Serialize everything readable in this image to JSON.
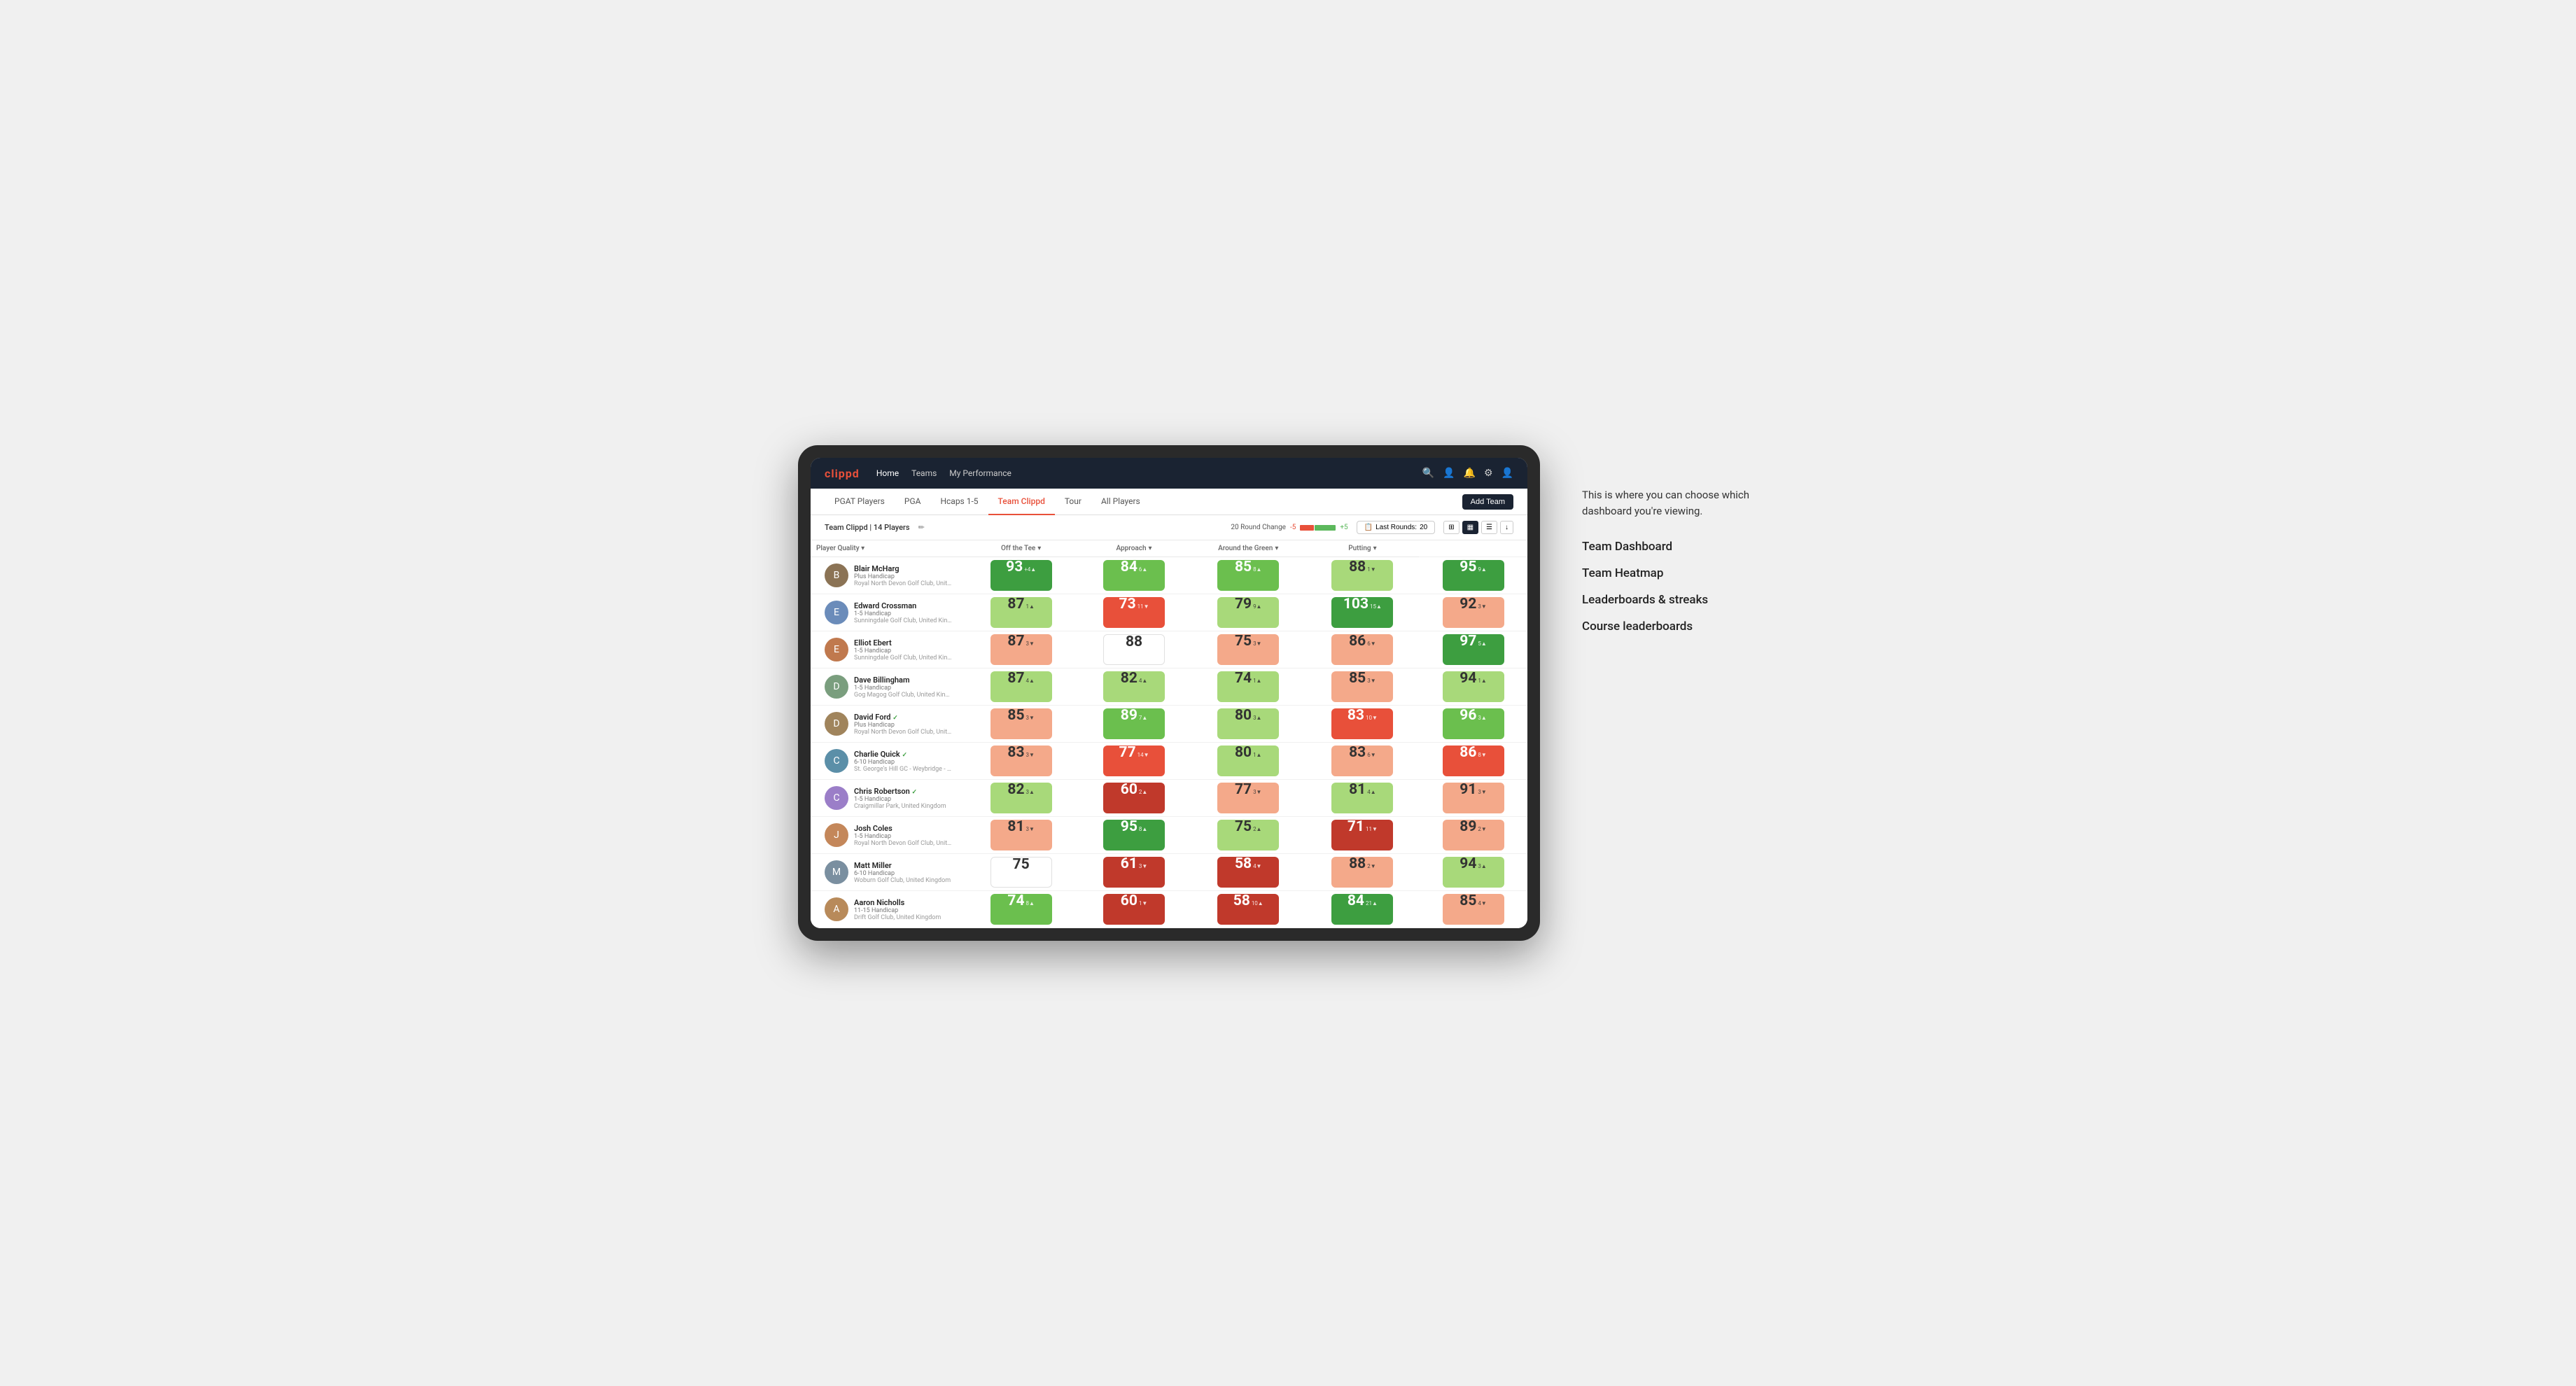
{
  "annotation": {
    "intro": "This is where you can choose which dashboard you're viewing.",
    "options": [
      {
        "id": "team-dashboard",
        "label": "Team Dashboard"
      },
      {
        "id": "team-heatmap",
        "label": "Team Heatmap"
      },
      {
        "id": "leaderboards",
        "label": "Leaderboards & streaks"
      },
      {
        "id": "course-leaderboards",
        "label": "Course leaderboards"
      }
    ]
  },
  "navbar": {
    "logo": "clippd",
    "links": [
      {
        "id": "home",
        "label": "Home",
        "active": true
      },
      {
        "id": "teams",
        "label": "Teams",
        "active": false
      },
      {
        "id": "my-performance",
        "label": "My Performance",
        "active": false
      }
    ]
  },
  "tabs": [
    {
      "id": "pgat",
      "label": "PGAT Players",
      "active": false
    },
    {
      "id": "pga",
      "label": "PGA",
      "active": false
    },
    {
      "id": "hcaps",
      "label": "Hcaps 1-5",
      "active": false
    },
    {
      "id": "team-clippd",
      "label": "Team Clippd",
      "active": true
    },
    {
      "id": "tour",
      "label": "Tour",
      "active": false
    },
    {
      "id": "all-players",
      "label": "All Players",
      "active": false
    }
  ],
  "add_team_btn": "Add Team",
  "sub_header": {
    "team_label": "Team Clippd",
    "player_count": "14 Players",
    "round_change_label": "20 Round Change",
    "round_change_neg": "-5",
    "round_change_pos": "+5",
    "last_rounds_label": "Last Rounds:",
    "last_rounds_value": "20"
  },
  "columns": {
    "player": "Player Quality",
    "off_tee": "Off the Tee",
    "approach": "Approach",
    "around_green": "Around the Green",
    "putting": "Putting"
  },
  "players": [
    {
      "name": "Blair McHarg",
      "handicap": "Plus Handicap",
      "club": "Royal North Devon Golf Club, United Kingdom",
      "avatar_color": "#8B7355",
      "player_quality": {
        "value": 93,
        "delta": "+4",
        "dir": "up",
        "bg": "bg-green-dark"
      },
      "off_tee": {
        "value": 84,
        "delta": "6",
        "dir": "up",
        "bg": "bg-green-med"
      },
      "approach": {
        "value": 85,
        "delta": "8",
        "dir": "up",
        "bg": "bg-green-med"
      },
      "around_green": {
        "value": 88,
        "delta": "1",
        "dir": "down",
        "bg": "bg-green-light"
      },
      "putting": {
        "value": 95,
        "delta": "9",
        "dir": "up",
        "bg": "bg-green-dark"
      }
    },
    {
      "name": "Edward Crossman",
      "handicap": "1-5 Handicap",
      "club": "Sunningdale Golf Club, United Kingdom",
      "avatar_color": "#6b8cba",
      "player_quality": {
        "value": 87,
        "delta": "1",
        "dir": "up",
        "bg": "bg-green-light"
      },
      "off_tee": {
        "value": 73,
        "delta": "11",
        "dir": "down",
        "bg": "bg-red-med"
      },
      "approach": {
        "value": 79,
        "delta": "9",
        "dir": "up",
        "bg": "bg-green-light"
      },
      "around_green": {
        "value": 103,
        "delta": "15",
        "dir": "up",
        "bg": "bg-green-dark"
      },
      "putting": {
        "value": 92,
        "delta": "3",
        "dir": "down",
        "bg": "bg-red-light"
      }
    },
    {
      "name": "Elliot Ebert",
      "handicap": "1-5 Handicap",
      "club": "Sunningdale Golf Club, United Kingdom",
      "avatar_color": "#c0794e",
      "player_quality": {
        "value": 87,
        "delta": "3",
        "dir": "down",
        "bg": "bg-red-light"
      },
      "off_tee": {
        "value": 88,
        "delta": "",
        "dir": "",
        "bg": "bg-white"
      },
      "approach": {
        "value": 75,
        "delta": "3",
        "dir": "down",
        "bg": "bg-red-light"
      },
      "around_green": {
        "value": 86,
        "delta": "6",
        "dir": "down",
        "bg": "bg-red-light"
      },
      "putting": {
        "value": 97,
        "delta": "5",
        "dir": "up",
        "bg": "bg-green-dark"
      }
    },
    {
      "name": "Dave Billingham",
      "handicap": "1-5 Handicap",
      "club": "Gog Magog Golf Club, United Kingdom",
      "avatar_color": "#7a9e7e",
      "player_quality": {
        "value": 87,
        "delta": "4",
        "dir": "up",
        "bg": "bg-green-light"
      },
      "off_tee": {
        "value": 82,
        "delta": "4",
        "dir": "up",
        "bg": "bg-green-light"
      },
      "approach": {
        "value": 74,
        "delta": "1",
        "dir": "up",
        "bg": "bg-green-light"
      },
      "around_green": {
        "value": 85,
        "delta": "3",
        "dir": "down",
        "bg": "bg-red-light"
      },
      "putting": {
        "value": 94,
        "delta": "1",
        "dir": "up",
        "bg": "bg-green-light"
      }
    },
    {
      "name": "David Ford",
      "handicap": "Plus Handicap",
      "club": "Royal North Devon Golf Club, United Kingdom",
      "avatar_color": "#a0845c",
      "verified": true,
      "player_quality": {
        "value": 85,
        "delta": "3",
        "dir": "down",
        "bg": "bg-red-light"
      },
      "off_tee": {
        "value": 89,
        "delta": "7",
        "dir": "up",
        "bg": "bg-green-med"
      },
      "approach": {
        "value": 80,
        "delta": "3",
        "dir": "up",
        "bg": "bg-green-light"
      },
      "around_green": {
        "value": 83,
        "delta": "10",
        "dir": "down",
        "bg": "bg-red-med"
      },
      "putting": {
        "value": 96,
        "delta": "3",
        "dir": "up",
        "bg": "bg-green-med"
      }
    },
    {
      "name": "Charlie Quick",
      "handicap": "6-10 Handicap",
      "club": "St. George's Hill GC - Weybridge - Surrey, Uni...",
      "avatar_color": "#5b8fa8",
      "verified": true,
      "player_quality": {
        "value": 83,
        "delta": "3",
        "dir": "down",
        "bg": "bg-red-light"
      },
      "off_tee": {
        "value": 77,
        "delta": "14",
        "dir": "down",
        "bg": "bg-red-med"
      },
      "approach": {
        "value": 80,
        "delta": "1",
        "dir": "up",
        "bg": "bg-green-light"
      },
      "around_green": {
        "value": 83,
        "delta": "6",
        "dir": "down",
        "bg": "bg-red-light"
      },
      "putting": {
        "value": 86,
        "delta": "8",
        "dir": "down",
        "bg": "bg-red-med"
      }
    },
    {
      "name": "Chris Robertson",
      "handicap": "1-5 Handicap",
      "club": "Craigmillar Park, United Kingdom",
      "avatar_color": "#9b7ec8",
      "verified": true,
      "player_quality": {
        "value": 82,
        "delta": "3",
        "dir": "up",
        "bg": "bg-green-light"
      },
      "off_tee": {
        "value": 60,
        "delta": "2",
        "dir": "up",
        "bg": "bg-red-dark"
      },
      "approach": {
        "value": 77,
        "delta": "3",
        "dir": "down",
        "bg": "bg-red-light"
      },
      "around_green": {
        "value": 81,
        "delta": "4",
        "dir": "up",
        "bg": "bg-green-light"
      },
      "putting": {
        "value": 91,
        "delta": "3",
        "dir": "down",
        "bg": "bg-red-light"
      }
    },
    {
      "name": "Josh Coles",
      "handicap": "1-5 Handicap",
      "club": "Royal North Devon Golf Club, United Kingdom",
      "avatar_color": "#c4875a",
      "player_quality": {
        "value": 81,
        "delta": "3",
        "dir": "down",
        "bg": "bg-red-light"
      },
      "off_tee": {
        "value": 95,
        "delta": "8",
        "dir": "up",
        "bg": "bg-green-dark"
      },
      "approach": {
        "value": 75,
        "delta": "2",
        "dir": "up",
        "bg": "bg-green-light"
      },
      "around_green": {
        "value": 71,
        "delta": "11",
        "dir": "down",
        "bg": "bg-red-dark"
      },
      "putting": {
        "value": 89,
        "delta": "2",
        "dir": "down",
        "bg": "bg-red-light"
      }
    },
    {
      "name": "Matt Miller",
      "handicap": "6-10 Handicap",
      "club": "Woburn Golf Club, United Kingdom",
      "avatar_color": "#7a8fa0",
      "player_quality": {
        "value": 75,
        "delta": "",
        "dir": "",
        "bg": "bg-white"
      },
      "off_tee": {
        "value": 61,
        "delta": "3",
        "dir": "down",
        "bg": "bg-red-dark"
      },
      "approach": {
        "value": 58,
        "delta": "4",
        "dir": "down",
        "bg": "bg-red-dark"
      },
      "around_green": {
        "value": 88,
        "delta": "2",
        "dir": "down",
        "bg": "bg-red-light"
      },
      "putting": {
        "value": 94,
        "delta": "3",
        "dir": "up",
        "bg": "bg-green-light"
      }
    },
    {
      "name": "Aaron Nicholls",
      "handicap": "11-15 Handicap",
      "club": "Drift Golf Club, United Kingdom",
      "avatar_color": "#b88a5a",
      "player_quality": {
        "value": 74,
        "delta": "8",
        "dir": "up",
        "bg": "bg-green-med"
      },
      "off_tee": {
        "value": 60,
        "delta": "1",
        "dir": "down",
        "bg": "bg-red-dark"
      },
      "approach": {
        "value": 58,
        "delta": "10",
        "dir": "up",
        "bg": "bg-red-dark"
      },
      "around_green": {
        "value": 84,
        "delta": "21",
        "dir": "up",
        "bg": "bg-green-dark"
      },
      "putting": {
        "value": 85,
        "delta": "4",
        "dir": "down",
        "bg": "bg-red-light"
      }
    }
  ]
}
